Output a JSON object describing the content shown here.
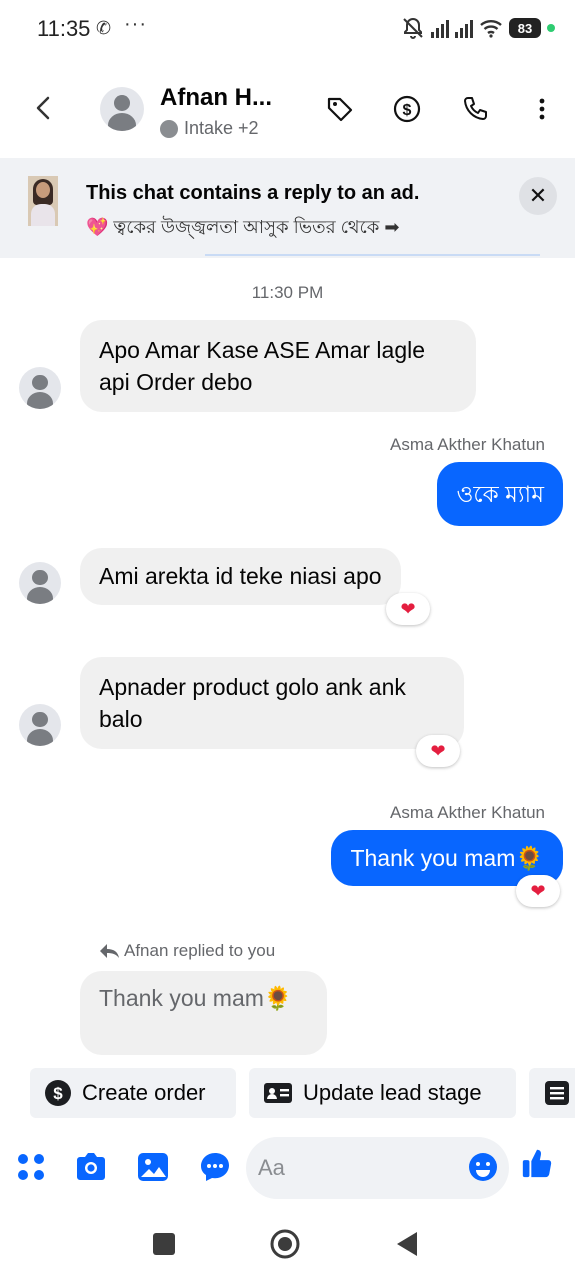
{
  "status_bar": {
    "time": "11:35",
    "dots": "···",
    "battery": "83"
  },
  "header": {
    "contact_name": "Afnan H...",
    "labels": "Intake +2"
  },
  "ad_banner": {
    "title": "This chat contains a reply to an ad.",
    "subtitle": "💖 ত্বকের উজ্জ্বলতা আসুক ভিতর থেকে ➡",
    "close": "✕"
  },
  "chat": {
    "timestamp": "11:30 PM",
    "messages": [
      {
        "direction": "in",
        "text_line1": "Apo Amar Kase ASE Amar lagle",
        "text_line2": "api Order debo"
      },
      {
        "direction": "out",
        "sender": "Asma Akther Khatun",
        "text": "ওকে ম্যাম"
      },
      {
        "direction": "in",
        "text": "Ami arekta id teke niasi apo",
        "reaction": "❤"
      },
      {
        "direction": "in",
        "text_line1": "Apnader product golo ank ank",
        "text_line2": "balo",
        "reaction": "❤"
      },
      {
        "direction": "out",
        "sender": "Asma Akther Khatun",
        "text": "Thank you mam🌻",
        "reaction": "❤"
      }
    ],
    "reply_notice": "Afnan replied to you",
    "reply_text": "Thank you mam🌻"
  },
  "quick_actions": {
    "create_order": "Create order",
    "update_lead_stage": "Update lead stage"
  },
  "composer": {
    "placeholder": "Aa"
  },
  "colors": {
    "accent": "#0866ff",
    "bubble_in": "#f0f0f0",
    "reaction_heart": "#e41e3f"
  }
}
